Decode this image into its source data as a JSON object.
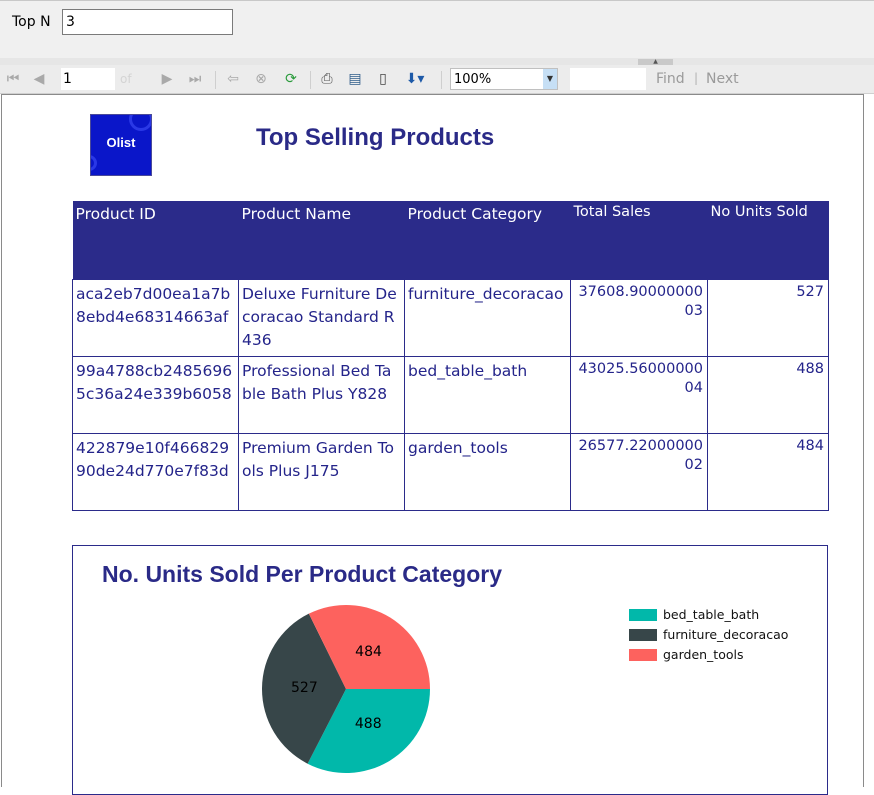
{
  "parameters": {
    "top_n_label": "Top N",
    "top_n_value": "3"
  },
  "toolbar": {
    "page_number": "1",
    "page_of": "of",
    "zoom": "100%",
    "find_label": "Find",
    "next_label": "Next",
    "separator": "|"
  },
  "report": {
    "logo_text": "Olist",
    "title": "Top Selling Products",
    "table": {
      "headers": [
        "Product ID",
        "Product Name",
        "Product Category",
        "Total Sales",
        "No Units Sold"
      ],
      "rows": [
        [
          "aca2eb7d00ea1a7b8ebd4e68314663af",
          "Deluxe Furniture Decoracao Standard R436",
          "furniture_decoracao",
          "37608.9000000003",
          "527"
        ],
        [
          "99a4788cb24856965c36a24e339b6058",
          "Professional Bed Table Bath Plus Y828",
          "bed_table_bath",
          "43025.5600000004",
          "488"
        ],
        [
          "422879e10f46682990de24d770e7f83d",
          "Premium Garden Tools Plus J175",
          "garden_tools",
          "26577.2200000002",
          "484"
        ]
      ]
    }
  },
  "chart_data": {
    "type": "pie",
    "title": "No. Units Sold Per Product Category",
    "categories": [
      "bed_table_bath",
      "furniture_decoracao",
      "garden_tools"
    ],
    "values": [
      488,
      527,
      484
    ],
    "colors": [
      "#01b8aa",
      "#374649",
      "#fd625e"
    ],
    "legend_position": "right"
  }
}
